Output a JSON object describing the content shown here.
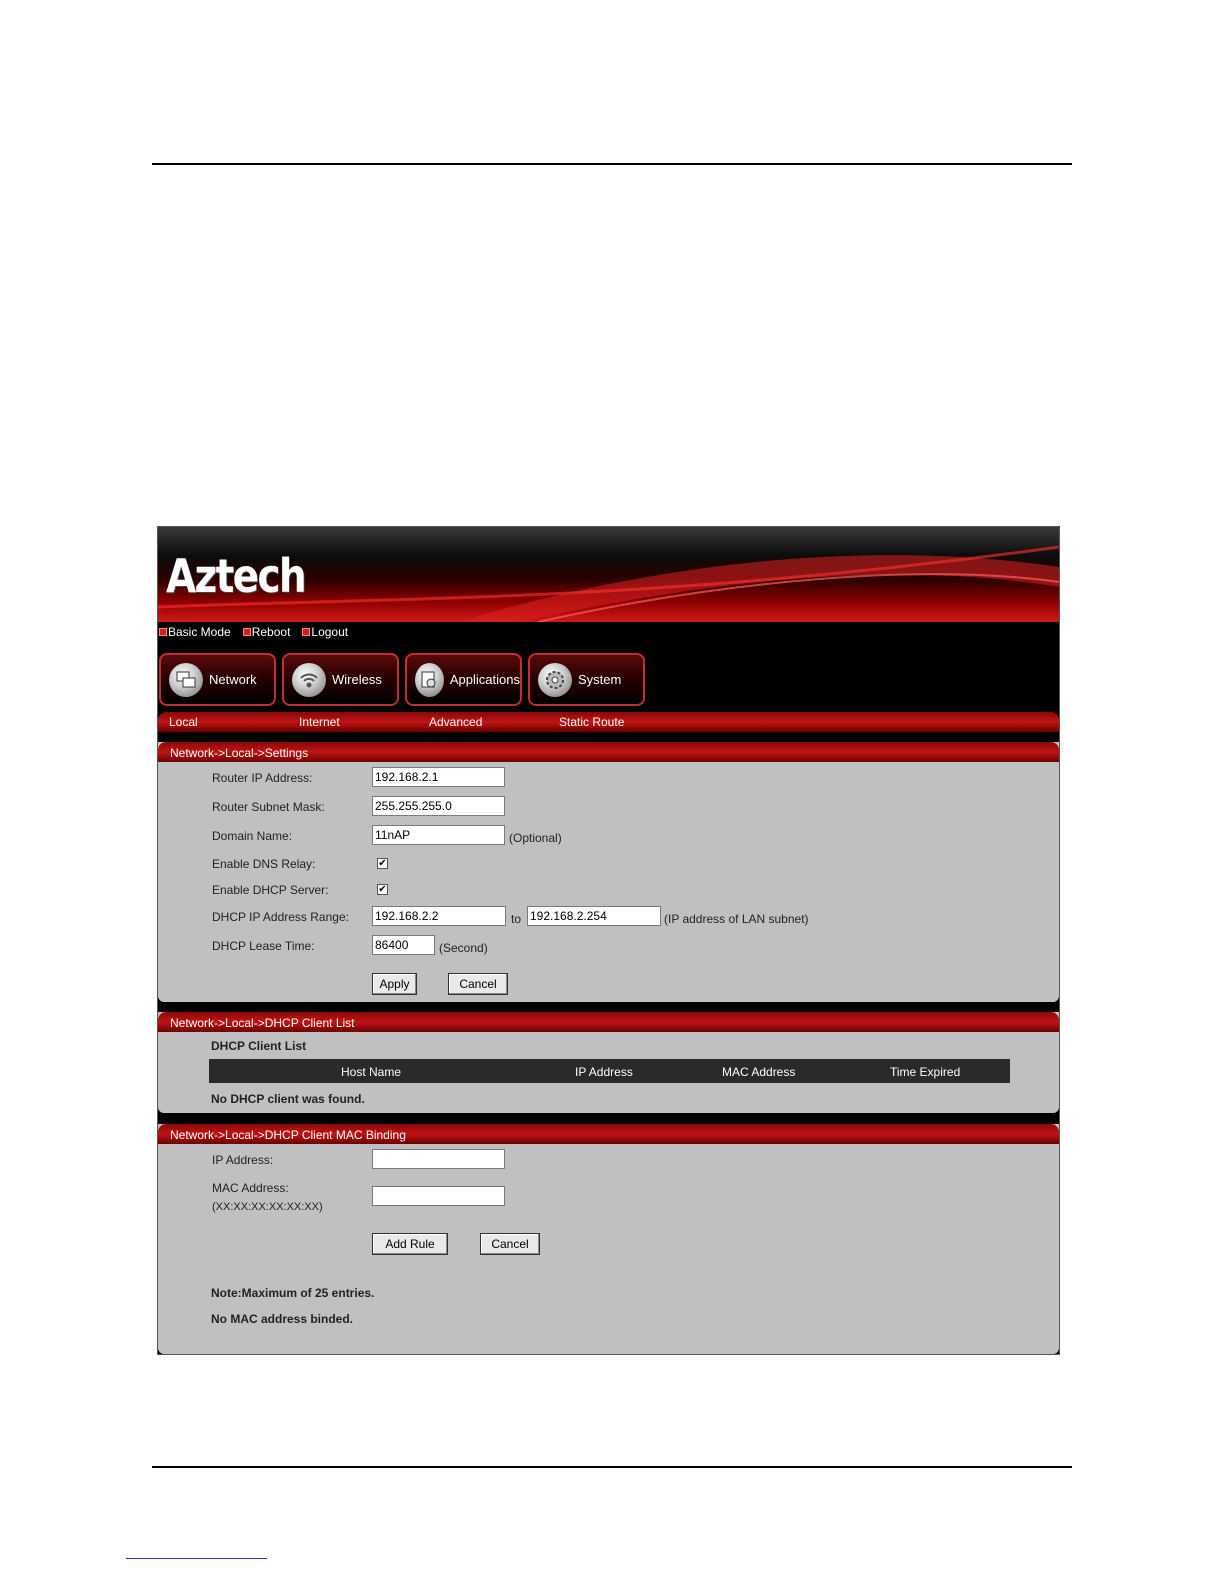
{
  "app": {
    "logo": "Aztech"
  },
  "top_links": [
    "Basic Mode",
    "Reboot",
    "Logout"
  ],
  "nav_buttons": [
    {
      "label": "Network",
      "icon": "network-icon"
    },
    {
      "label": "Wireless",
      "icon": "wireless-icon"
    },
    {
      "label": "Applications",
      "icon": "applications-icon"
    },
    {
      "label": "System",
      "icon": "system-icon"
    }
  ],
  "sub_nav": [
    "Local",
    "Internet",
    "Advanced",
    "Static Route"
  ],
  "settings": {
    "title": "Network->Local->Settings",
    "router_ip_label": "Router IP Address:",
    "router_ip": "192.168.2.1",
    "subnet_label": "Router Subnet Mask:",
    "subnet": "255.255.255.0",
    "domain_label": "Domain Name:",
    "domain": "11nAP",
    "domain_hint": "(Optional)",
    "dns_relay_label": "Enable DNS Relay:",
    "dns_relay_checked": true,
    "dhcp_server_label": "Enable DHCP Server:",
    "dhcp_server_checked": true,
    "range_label": "DHCP IP Address Range:",
    "range_start": "192.168.2.2",
    "range_to": "to",
    "range_end": "192.168.2.254",
    "range_hint": "(IP address of LAN subnet)",
    "lease_label": "DHCP Lease Time:",
    "lease": "86400",
    "lease_hint": "(Second)",
    "apply": "Apply",
    "cancel": "Cancel"
  },
  "client_list": {
    "title": "Network->Local->DHCP Client List",
    "heading": "DHCP Client List",
    "columns": [
      "Host Name",
      "IP Address",
      "MAC Address",
      "Time Expired"
    ],
    "empty": "No DHCP client was found."
  },
  "mac_binding": {
    "title": "Network->Local->DHCP Client MAC Binding",
    "ip_label": "IP Address:",
    "ip_value": "",
    "mac_label": "MAC Address:",
    "mac_format": "(XX:XX:XX:XX:XX:XX)",
    "mac_value": "",
    "add_rule": "Add Rule",
    "cancel": "Cancel",
    "note": "Note:Maximum of 25 entries.",
    "empty": "No MAC address binded."
  },
  "colors": {
    "accent": "#c01414",
    "panel": "#c0c0c0",
    "header_bg": "#000000"
  }
}
